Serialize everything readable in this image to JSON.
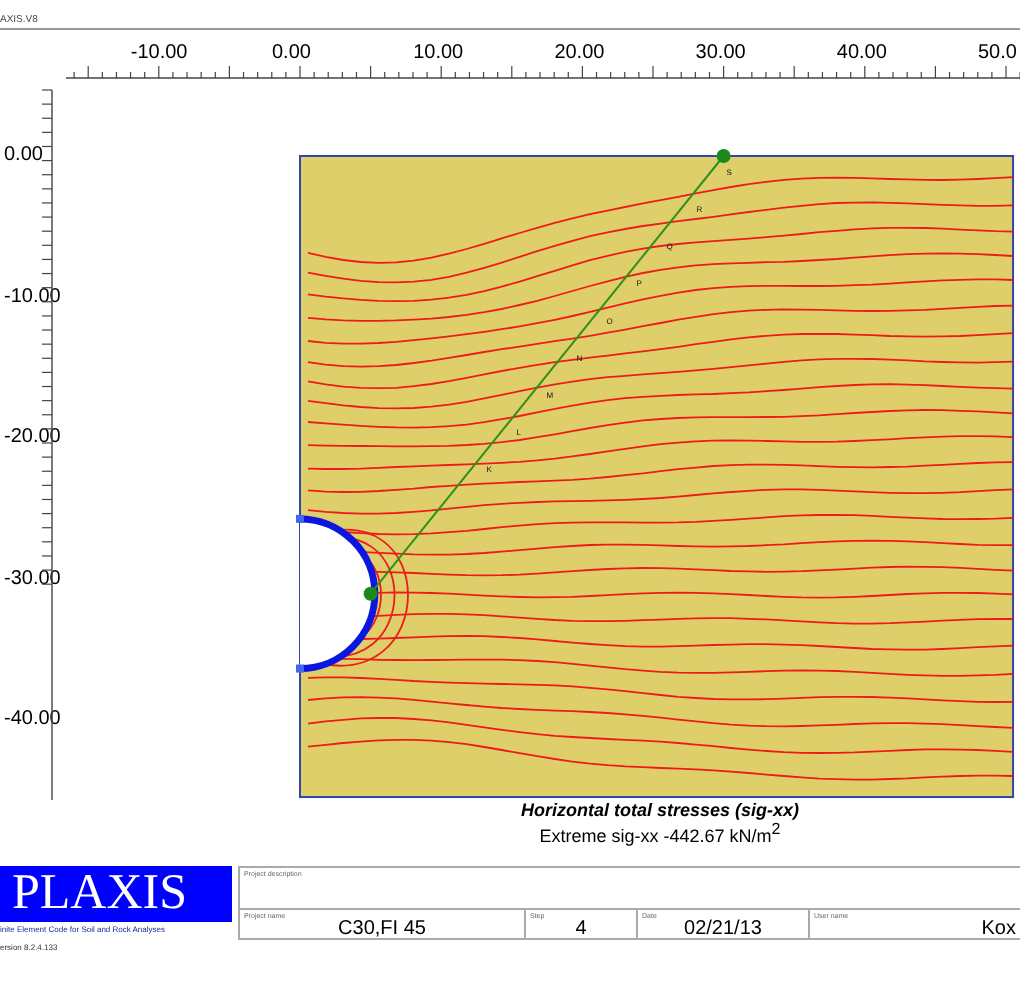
{
  "window": {
    "title": "AXIS.V8"
  },
  "x_axis": {
    "ticks": [
      "-10.00",
      "0.00",
      "10.00",
      "20.00",
      "30.00",
      "40.00",
      "50.0"
    ]
  },
  "y_axis": {
    "ticks": [
      "0.00",
      "-10.00",
      "-20.00",
      "-30.00",
      "-40.00"
    ]
  },
  "plot": {
    "point_labels": [
      "K",
      "L",
      "M",
      "N",
      "O",
      "P",
      "Q",
      "R",
      "S"
    ]
  },
  "caption": {
    "title": "Horizontal total stresses (sig-xx)",
    "subtitle": "Extreme sig-xx  -442.67 kN/m$^{2}$"
  },
  "footer": {
    "logo": "PLAXIS",
    "tagline": "inite Element Code for Soil and Rock Analyses",
    "version": "ersion 8.2.4.133",
    "fields": [
      {
        "label": "Project description"
      },
      {
        "label": "Project name",
        "value": "C30,FI 45"
      },
      {
        "label": "Step",
        "value": "4"
      },
      {
        "label": "Date",
        "value": "02/21/13"
      },
      {
        "label": "User name",
        "value": "Kox"
      }
    ]
  }
}
